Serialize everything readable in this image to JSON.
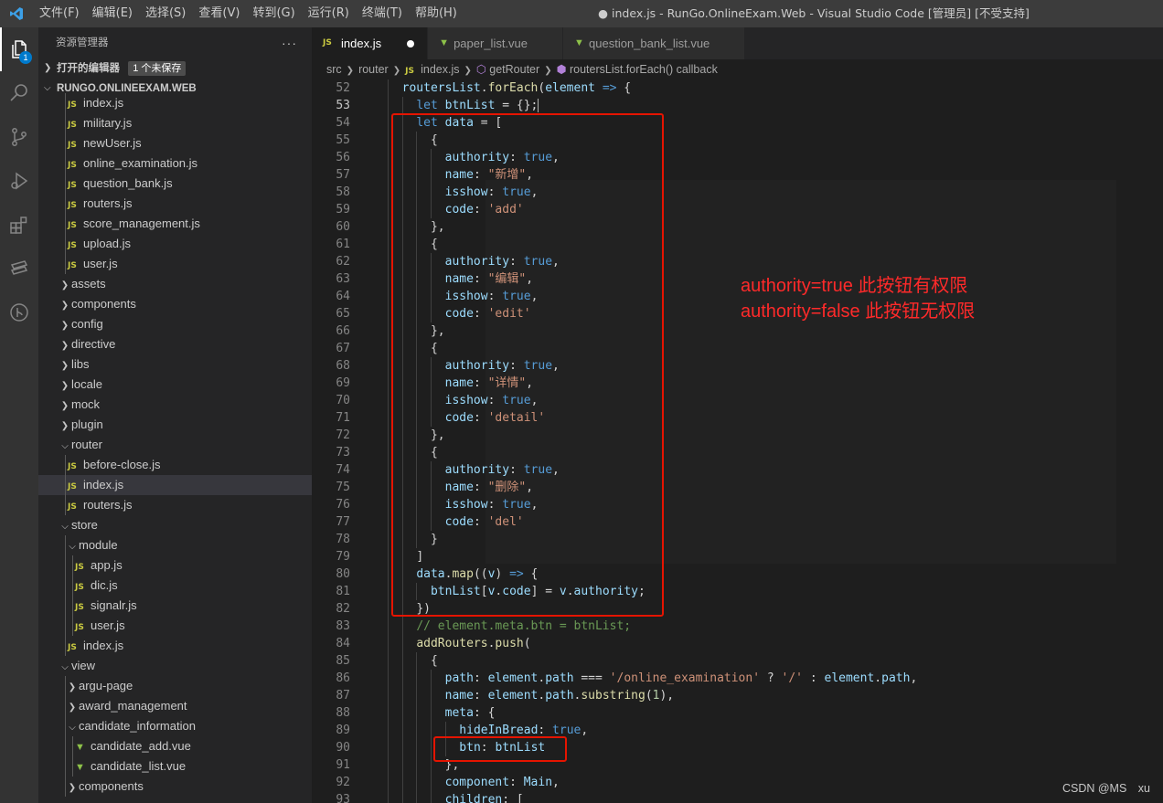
{
  "titlebar": {
    "menu": [
      "文件(F)",
      "编辑(E)",
      "选择(S)",
      "查看(V)",
      "转到(G)",
      "运行(R)",
      "终端(T)",
      "帮助(H)"
    ],
    "window_title": "● index.js - RunGo.OnlineExam.Web - Visual Studio Code [管理员] [不受支持]"
  },
  "activitybar": {
    "icons": [
      "explorer-icon",
      "search-icon",
      "source-control-icon",
      "run-debug-icon",
      "extensions-icon",
      "remote-icon",
      "git-lens-icon"
    ],
    "explorer_badge": "1"
  },
  "sidebar": {
    "title": "资源管理器",
    "more": "···",
    "open_editors_label": "打开的编辑器",
    "unsaved_badge": "1 个未保存",
    "workspace_label": "RUNGO.ONLINEEXAM.WEB",
    "tree": [
      {
        "label": "index.js",
        "type": "js",
        "depth": 3
      },
      {
        "label": "military.js",
        "type": "js",
        "depth": 3
      },
      {
        "label": "newUser.js",
        "type": "js",
        "depth": 3
      },
      {
        "label": "online_examination.js",
        "type": "js",
        "depth": 3
      },
      {
        "label": "question_bank.js",
        "type": "js",
        "depth": 3
      },
      {
        "label": "routers.js",
        "type": "js",
        "depth": 3
      },
      {
        "label": "score_management.js",
        "type": "js",
        "depth": 3
      },
      {
        "label": "upload.js",
        "type": "js",
        "depth": 3
      },
      {
        "label": "user.js",
        "type": "js",
        "depth": 3
      },
      {
        "label": "assets",
        "type": "folder",
        "depth": 2,
        "open": false
      },
      {
        "label": "components",
        "type": "folder",
        "depth": 2,
        "open": false
      },
      {
        "label": "config",
        "type": "folder",
        "depth": 2,
        "open": false
      },
      {
        "label": "directive",
        "type": "folder",
        "depth": 2,
        "open": false
      },
      {
        "label": "libs",
        "type": "folder",
        "depth": 2,
        "open": false
      },
      {
        "label": "locale",
        "type": "folder",
        "depth": 2,
        "open": false
      },
      {
        "label": "mock",
        "type": "folder",
        "depth": 2,
        "open": false
      },
      {
        "label": "plugin",
        "type": "folder",
        "depth": 2,
        "open": false
      },
      {
        "label": "router",
        "type": "folder",
        "depth": 2,
        "open": true
      },
      {
        "label": "before-close.js",
        "type": "js",
        "depth": 3
      },
      {
        "label": "index.js",
        "type": "js",
        "depth": 3,
        "selected": true
      },
      {
        "label": "routers.js",
        "type": "js",
        "depth": 3
      },
      {
        "label": "store",
        "type": "folder",
        "depth": 2,
        "open": true
      },
      {
        "label": "module",
        "type": "folder",
        "depth": 3,
        "open": true
      },
      {
        "label": "app.js",
        "type": "js",
        "depth": 4
      },
      {
        "label": "dic.js",
        "type": "js",
        "depth": 4
      },
      {
        "label": "signalr.js",
        "type": "js",
        "depth": 4
      },
      {
        "label": "user.js",
        "type": "js",
        "depth": 4
      },
      {
        "label": "index.js",
        "type": "js",
        "depth": 3
      },
      {
        "label": "view",
        "type": "folder",
        "depth": 2,
        "open": true
      },
      {
        "label": "argu-page",
        "type": "folder",
        "depth": 3,
        "open": false
      },
      {
        "label": "award_management",
        "type": "folder",
        "depth": 3,
        "open": false
      },
      {
        "label": "candidate_information",
        "type": "folder",
        "depth": 3,
        "open": true
      },
      {
        "label": "candidate_add.vue",
        "type": "vue",
        "depth": 4
      },
      {
        "label": "candidate_list.vue",
        "type": "vue",
        "depth": 4
      },
      {
        "label": "components",
        "type": "folder",
        "depth": 3,
        "open": false
      }
    ]
  },
  "tabs": [
    {
      "label": "index.js",
      "icon": "JS",
      "active": true,
      "dirty": true
    },
    {
      "label": "paper_list.vue",
      "icon": "vue",
      "active": false
    },
    {
      "label": "question_bank_list.vue",
      "icon": "vue",
      "active": false
    }
  ],
  "breadcrumb": {
    "parts": [
      "src",
      "router",
      "index.js",
      "getRouter",
      "routersList.forEach() callback"
    ]
  },
  "code": {
    "current_line": 53,
    "lines": [
      {
        "n": 52,
        "indent": 2,
        "tokens": [
          [
            "id",
            "routersList"
          ],
          [
            "p",
            "."
          ],
          [
            "fn",
            "forEach"
          ],
          [
            "p",
            "("
          ],
          [
            "id",
            "element"
          ],
          [
            "p",
            " "
          ],
          [
            "kw",
            "=>"
          ],
          [
            "p",
            " {"
          ]
        ]
      },
      {
        "n": 53,
        "indent": 3,
        "tokens": [
          [
            "kw",
            "let"
          ],
          [
            "p",
            " "
          ],
          [
            "id",
            "btnList"
          ],
          [
            "p",
            " = {};"
          ]
        ]
      },
      {
        "n": 54,
        "indent": 3,
        "tokens": [
          [
            "kw",
            "let"
          ],
          [
            "p",
            " "
          ],
          [
            "id",
            "data"
          ],
          [
            "p",
            " = ["
          ]
        ]
      },
      {
        "n": 55,
        "indent": 4,
        "tokens": [
          [
            "p",
            "{"
          ]
        ]
      },
      {
        "n": 56,
        "indent": 5,
        "tokens": [
          [
            "id",
            "authority"
          ],
          [
            "p",
            ": "
          ],
          [
            "kw",
            "true"
          ],
          [
            "p",
            ","
          ]
        ]
      },
      {
        "n": 57,
        "indent": 5,
        "tokens": [
          [
            "id",
            "name"
          ],
          [
            "p",
            ": "
          ],
          [
            "str",
            "\"新增\""
          ],
          [
            "p",
            ","
          ]
        ]
      },
      {
        "n": 58,
        "indent": 5,
        "tokens": [
          [
            "id",
            "isshow"
          ],
          [
            "p",
            ": "
          ],
          [
            "kw",
            "true"
          ],
          [
            "p",
            ","
          ]
        ]
      },
      {
        "n": 59,
        "indent": 5,
        "tokens": [
          [
            "id",
            "code"
          ],
          [
            "p",
            ": "
          ],
          [
            "str",
            "'add'"
          ]
        ]
      },
      {
        "n": 60,
        "indent": 4,
        "tokens": [
          [
            "p",
            "},"
          ]
        ]
      },
      {
        "n": 61,
        "indent": 4,
        "tokens": [
          [
            "p",
            "{"
          ]
        ]
      },
      {
        "n": 62,
        "indent": 5,
        "tokens": [
          [
            "id",
            "authority"
          ],
          [
            "p",
            ": "
          ],
          [
            "kw",
            "true"
          ],
          [
            "p",
            ","
          ]
        ]
      },
      {
        "n": 63,
        "indent": 5,
        "tokens": [
          [
            "id",
            "name"
          ],
          [
            "p",
            ": "
          ],
          [
            "str",
            "\"编辑\""
          ],
          [
            "p",
            ","
          ]
        ]
      },
      {
        "n": 64,
        "indent": 5,
        "tokens": [
          [
            "id",
            "isshow"
          ],
          [
            "p",
            ": "
          ],
          [
            "kw",
            "true"
          ],
          [
            "p",
            ","
          ]
        ]
      },
      {
        "n": 65,
        "indent": 5,
        "tokens": [
          [
            "id",
            "code"
          ],
          [
            "p",
            ": "
          ],
          [
            "str",
            "'edit'"
          ]
        ]
      },
      {
        "n": 66,
        "indent": 4,
        "tokens": [
          [
            "p",
            "},"
          ]
        ]
      },
      {
        "n": 67,
        "indent": 4,
        "tokens": [
          [
            "p",
            "{"
          ]
        ]
      },
      {
        "n": 68,
        "indent": 5,
        "tokens": [
          [
            "id",
            "authority"
          ],
          [
            "p",
            ": "
          ],
          [
            "kw",
            "true"
          ],
          [
            "p",
            ","
          ]
        ]
      },
      {
        "n": 69,
        "indent": 5,
        "tokens": [
          [
            "id",
            "name"
          ],
          [
            "p",
            ": "
          ],
          [
            "str",
            "\"详情\""
          ],
          [
            "p",
            ","
          ]
        ]
      },
      {
        "n": 70,
        "indent": 5,
        "tokens": [
          [
            "id",
            "isshow"
          ],
          [
            "p",
            ": "
          ],
          [
            "kw",
            "true"
          ],
          [
            "p",
            ","
          ]
        ]
      },
      {
        "n": 71,
        "indent": 5,
        "tokens": [
          [
            "id",
            "code"
          ],
          [
            "p",
            ": "
          ],
          [
            "str",
            "'detail'"
          ]
        ]
      },
      {
        "n": 72,
        "indent": 4,
        "tokens": [
          [
            "p",
            "},"
          ]
        ]
      },
      {
        "n": 73,
        "indent": 4,
        "tokens": [
          [
            "p",
            "{"
          ]
        ]
      },
      {
        "n": 74,
        "indent": 5,
        "tokens": [
          [
            "id",
            "authority"
          ],
          [
            "p",
            ": "
          ],
          [
            "kw",
            "true"
          ],
          [
            "p",
            ","
          ]
        ]
      },
      {
        "n": 75,
        "indent": 5,
        "tokens": [
          [
            "id",
            "name"
          ],
          [
            "p",
            ": "
          ],
          [
            "str",
            "\"删除\""
          ],
          [
            "p",
            ","
          ]
        ]
      },
      {
        "n": 76,
        "indent": 5,
        "tokens": [
          [
            "id",
            "isshow"
          ],
          [
            "p",
            ": "
          ],
          [
            "kw",
            "true"
          ],
          [
            "p",
            ","
          ]
        ]
      },
      {
        "n": 77,
        "indent": 5,
        "tokens": [
          [
            "id",
            "code"
          ],
          [
            "p",
            ": "
          ],
          [
            "str",
            "'del'"
          ]
        ]
      },
      {
        "n": 78,
        "indent": 4,
        "tokens": [
          [
            "p",
            "}"
          ]
        ]
      },
      {
        "n": 79,
        "indent": 3,
        "tokens": [
          [
            "p",
            "]"
          ]
        ]
      },
      {
        "n": 80,
        "indent": 3,
        "tokens": [
          [
            "id",
            "data"
          ],
          [
            "p",
            "."
          ],
          [
            "fn",
            "map"
          ],
          [
            "p",
            "(("
          ],
          [
            "id",
            "v"
          ],
          [
            "p",
            ") "
          ],
          [
            "kw",
            "=>"
          ],
          [
            "p",
            " {"
          ]
        ]
      },
      {
        "n": 81,
        "indent": 4,
        "tokens": [
          [
            "id",
            "btnList"
          ],
          [
            "p",
            "["
          ],
          [
            "id",
            "v"
          ],
          [
            "p",
            "."
          ],
          [
            "id",
            "code"
          ],
          [
            "p",
            "] = "
          ],
          [
            "id",
            "v"
          ],
          [
            "p",
            "."
          ],
          [
            "id",
            "authority"
          ],
          [
            "p",
            ";"
          ]
        ]
      },
      {
        "n": 82,
        "indent": 3,
        "tokens": [
          [
            "p",
            "})"
          ]
        ]
      },
      {
        "n": 83,
        "indent": 3,
        "tokens": [
          [
            "cm",
            "// element.meta.btn = btnList;"
          ]
        ]
      },
      {
        "n": 84,
        "indent": 3,
        "tokens": [
          [
            "fn",
            "addRouters"
          ],
          [
            "p",
            "."
          ],
          [
            "fn",
            "push"
          ],
          [
            "p",
            "("
          ]
        ]
      },
      {
        "n": 85,
        "indent": 4,
        "tokens": [
          [
            "p",
            "{"
          ]
        ]
      },
      {
        "n": 86,
        "indent": 5,
        "tokens": [
          [
            "id",
            "path"
          ],
          [
            "p",
            ": "
          ],
          [
            "id",
            "element"
          ],
          [
            "p",
            "."
          ],
          [
            "id",
            "path"
          ],
          [
            "p",
            " === "
          ],
          [
            "str",
            "'/online_examination'"
          ],
          [
            "p",
            " ? "
          ],
          [
            "str",
            "'/'"
          ],
          [
            "p",
            " : "
          ],
          [
            "id",
            "element"
          ],
          [
            "p",
            "."
          ],
          [
            "id",
            "path"
          ],
          [
            "p",
            ","
          ]
        ]
      },
      {
        "n": 87,
        "indent": 5,
        "tokens": [
          [
            "id",
            "name"
          ],
          [
            "p",
            ": "
          ],
          [
            "id",
            "element"
          ],
          [
            "p",
            "."
          ],
          [
            "id",
            "path"
          ],
          [
            "p",
            "."
          ],
          [
            "fn",
            "substring"
          ],
          [
            "p",
            "("
          ],
          [
            "num",
            "1"
          ],
          [
            "p",
            "),"
          ]
        ]
      },
      {
        "n": 88,
        "indent": 5,
        "tokens": [
          [
            "id",
            "meta"
          ],
          [
            "p",
            ": {"
          ]
        ]
      },
      {
        "n": 89,
        "indent": 6,
        "tokens": [
          [
            "id",
            "hideInBread"
          ],
          [
            "p",
            ": "
          ],
          [
            "kw",
            "true"
          ],
          [
            "p",
            ","
          ]
        ]
      },
      {
        "n": 90,
        "indent": 6,
        "tokens": [
          [
            "id",
            "btn"
          ],
          [
            "p",
            ": "
          ],
          [
            "id",
            "btnList"
          ]
        ]
      },
      {
        "n": 91,
        "indent": 5,
        "tokens": [
          [
            "p",
            "},"
          ]
        ]
      },
      {
        "n": 92,
        "indent": 5,
        "tokens": [
          [
            "id",
            "component"
          ],
          [
            "p",
            ": "
          ],
          [
            "id",
            "Main"
          ],
          [
            "p",
            ","
          ]
        ]
      },
      {
        "n": 93,
        "indent": 5,
        "tokens": [
          [
            "id",
            "children"
          ],
          [
            "p",
            ": ["
          ]
        ]
      }
    ]
  },
  "annotations": {
    "line1": "authority=true 此按钮有权限",
    "line2": "authority=false 此按钮无权限"
  },
  "watermark": "CSDN @MS　xu",
  "colors": {
    "annotation_red": "#e51400",
    "activity_bar": "#333333",
    "sidebar": "#252526",
    "editor": "#1e1e1e",
    "titlebar": "#3c3c3c"
  }
}
